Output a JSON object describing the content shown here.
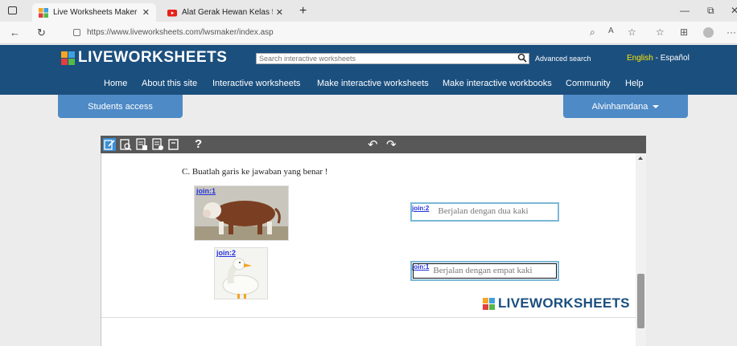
{
  "browser": {
    "tabs": [
      {
        "title": "Live Worksheets Maker",
        "active": true
      },
      {
        "title": "Alat Gerak Hewan Kelas 5 lengka",
        "active": false
      }
    ],
    "url": "https://www.liveworksheets.com/lwsmaker/index.asp"
  },
  "site": {
    "logo": "LIVEWORKSHEETS",
    "search_placeholder": "Search interactive worksheets",
    "advanced_search": "Advanced search",
    "lang_en": "English",
    "lang_sep": " - ",
    "lang_es": "Español",
    "menu": [
      "Home",
      "About this site",
      "Interactive worksheets",
      "Make interactive worksheets",
      "Make interactive workbooks",
      "Community",
      "Help"
    ],
    "students_access": "Students access",
    "username": "Alvinhamdana"
  },
  "editor": {
    "help_label": "?"
  },
  "worksheet": {
    "question": "C.   Buatlah garis ke jawaban yang benar !",
    "images": [
      {
        "join_label": "join:1",
        "subject": "bull"
      },
      {
        "join_label": "join:2",
        "subject": "duck"
      }
    ],
    "answers": [
      {
        "join_label": "join:2",
        "text": "Berjalan dengan dua kaki"
      },
      {
        "join_label": "join:1",
        "text": "Berjalan dengan empat kaki"
      }
    ],
    "brand": "LIVEWORKSHEETS"
  },
  "colors": {
    "header_bg": "#1b4f7e",
    "button_bg": "#4e8ac6",
    "lang_highlight": "#ffe600",
    "toolbar_bg": "#585858"
  }
}
